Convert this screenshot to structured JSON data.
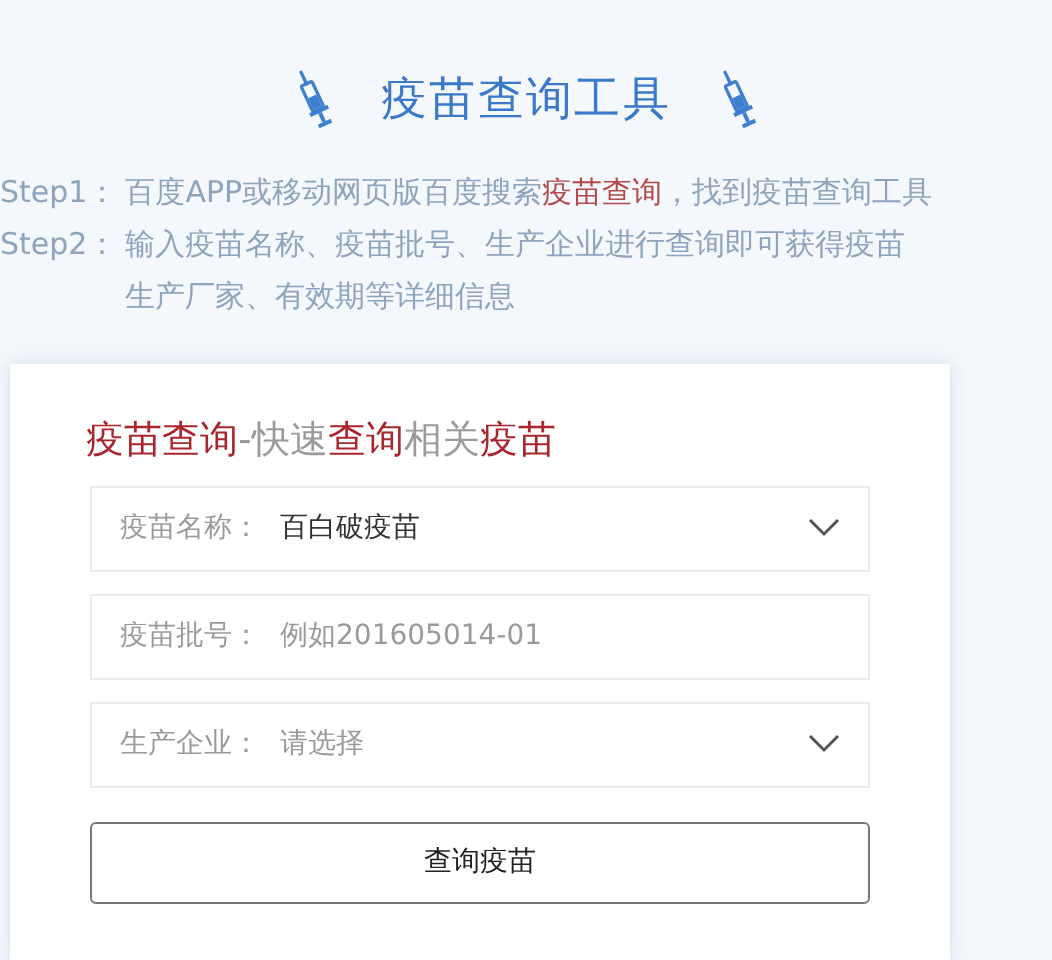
{
  "header": {
    "title": "疫苗查询工具"
  },
  "steps": [
    {
      "label": "Step1：",
      "lines": [
        [
          {
            "text": "百度APP或移动网页版百度搜索",
            "highlight": false
          },
          {
            "text": "疫苗查询",
            "highlight": true
          },
          {
            "text": "，找到疫苗查询工具",
            "highlight": false
          }
        ]
      ]
    },
    {
      "label": "Step2：",
      "lines": [
        [
          {
            "text": "输入疫苗名称、疫苗批号、生产企业进行查询即可获得疫苗",
            "highlight": false
          }
        ],
        [
          {
            "text": "生产厂家、有效期等详细信息",
            "highlight": false
          }
        ]
      ]
    }
  ],
  "card": {
    "title_segments": [
      {
        "text": "疫苗查询",
        "highlight": true
      },
      {
        "text": "-快速",
        "highlight": false
      },
      {
        "text": "查询",
        "highlight": true
      },
      {
        "text": "相关",
        "highlight": false
      },
      {
        "text": "疫苗",
        "highlight": true
      }
    ],
    "fields": [
      {
        "kind": "select",
        "label": "疫苗名称：",
        "value": "百白破疫苗"
      },
      {
        "kind": "input",
        "label": "疫苗批号：",
        "placeholder": "例如201605014-01"
      },
      {
        "kind": "select",
        "label": "生产企业：",
        "placeholder": "请选择"
      }
    ],
    "button": "查询疫苗"
  }
}
